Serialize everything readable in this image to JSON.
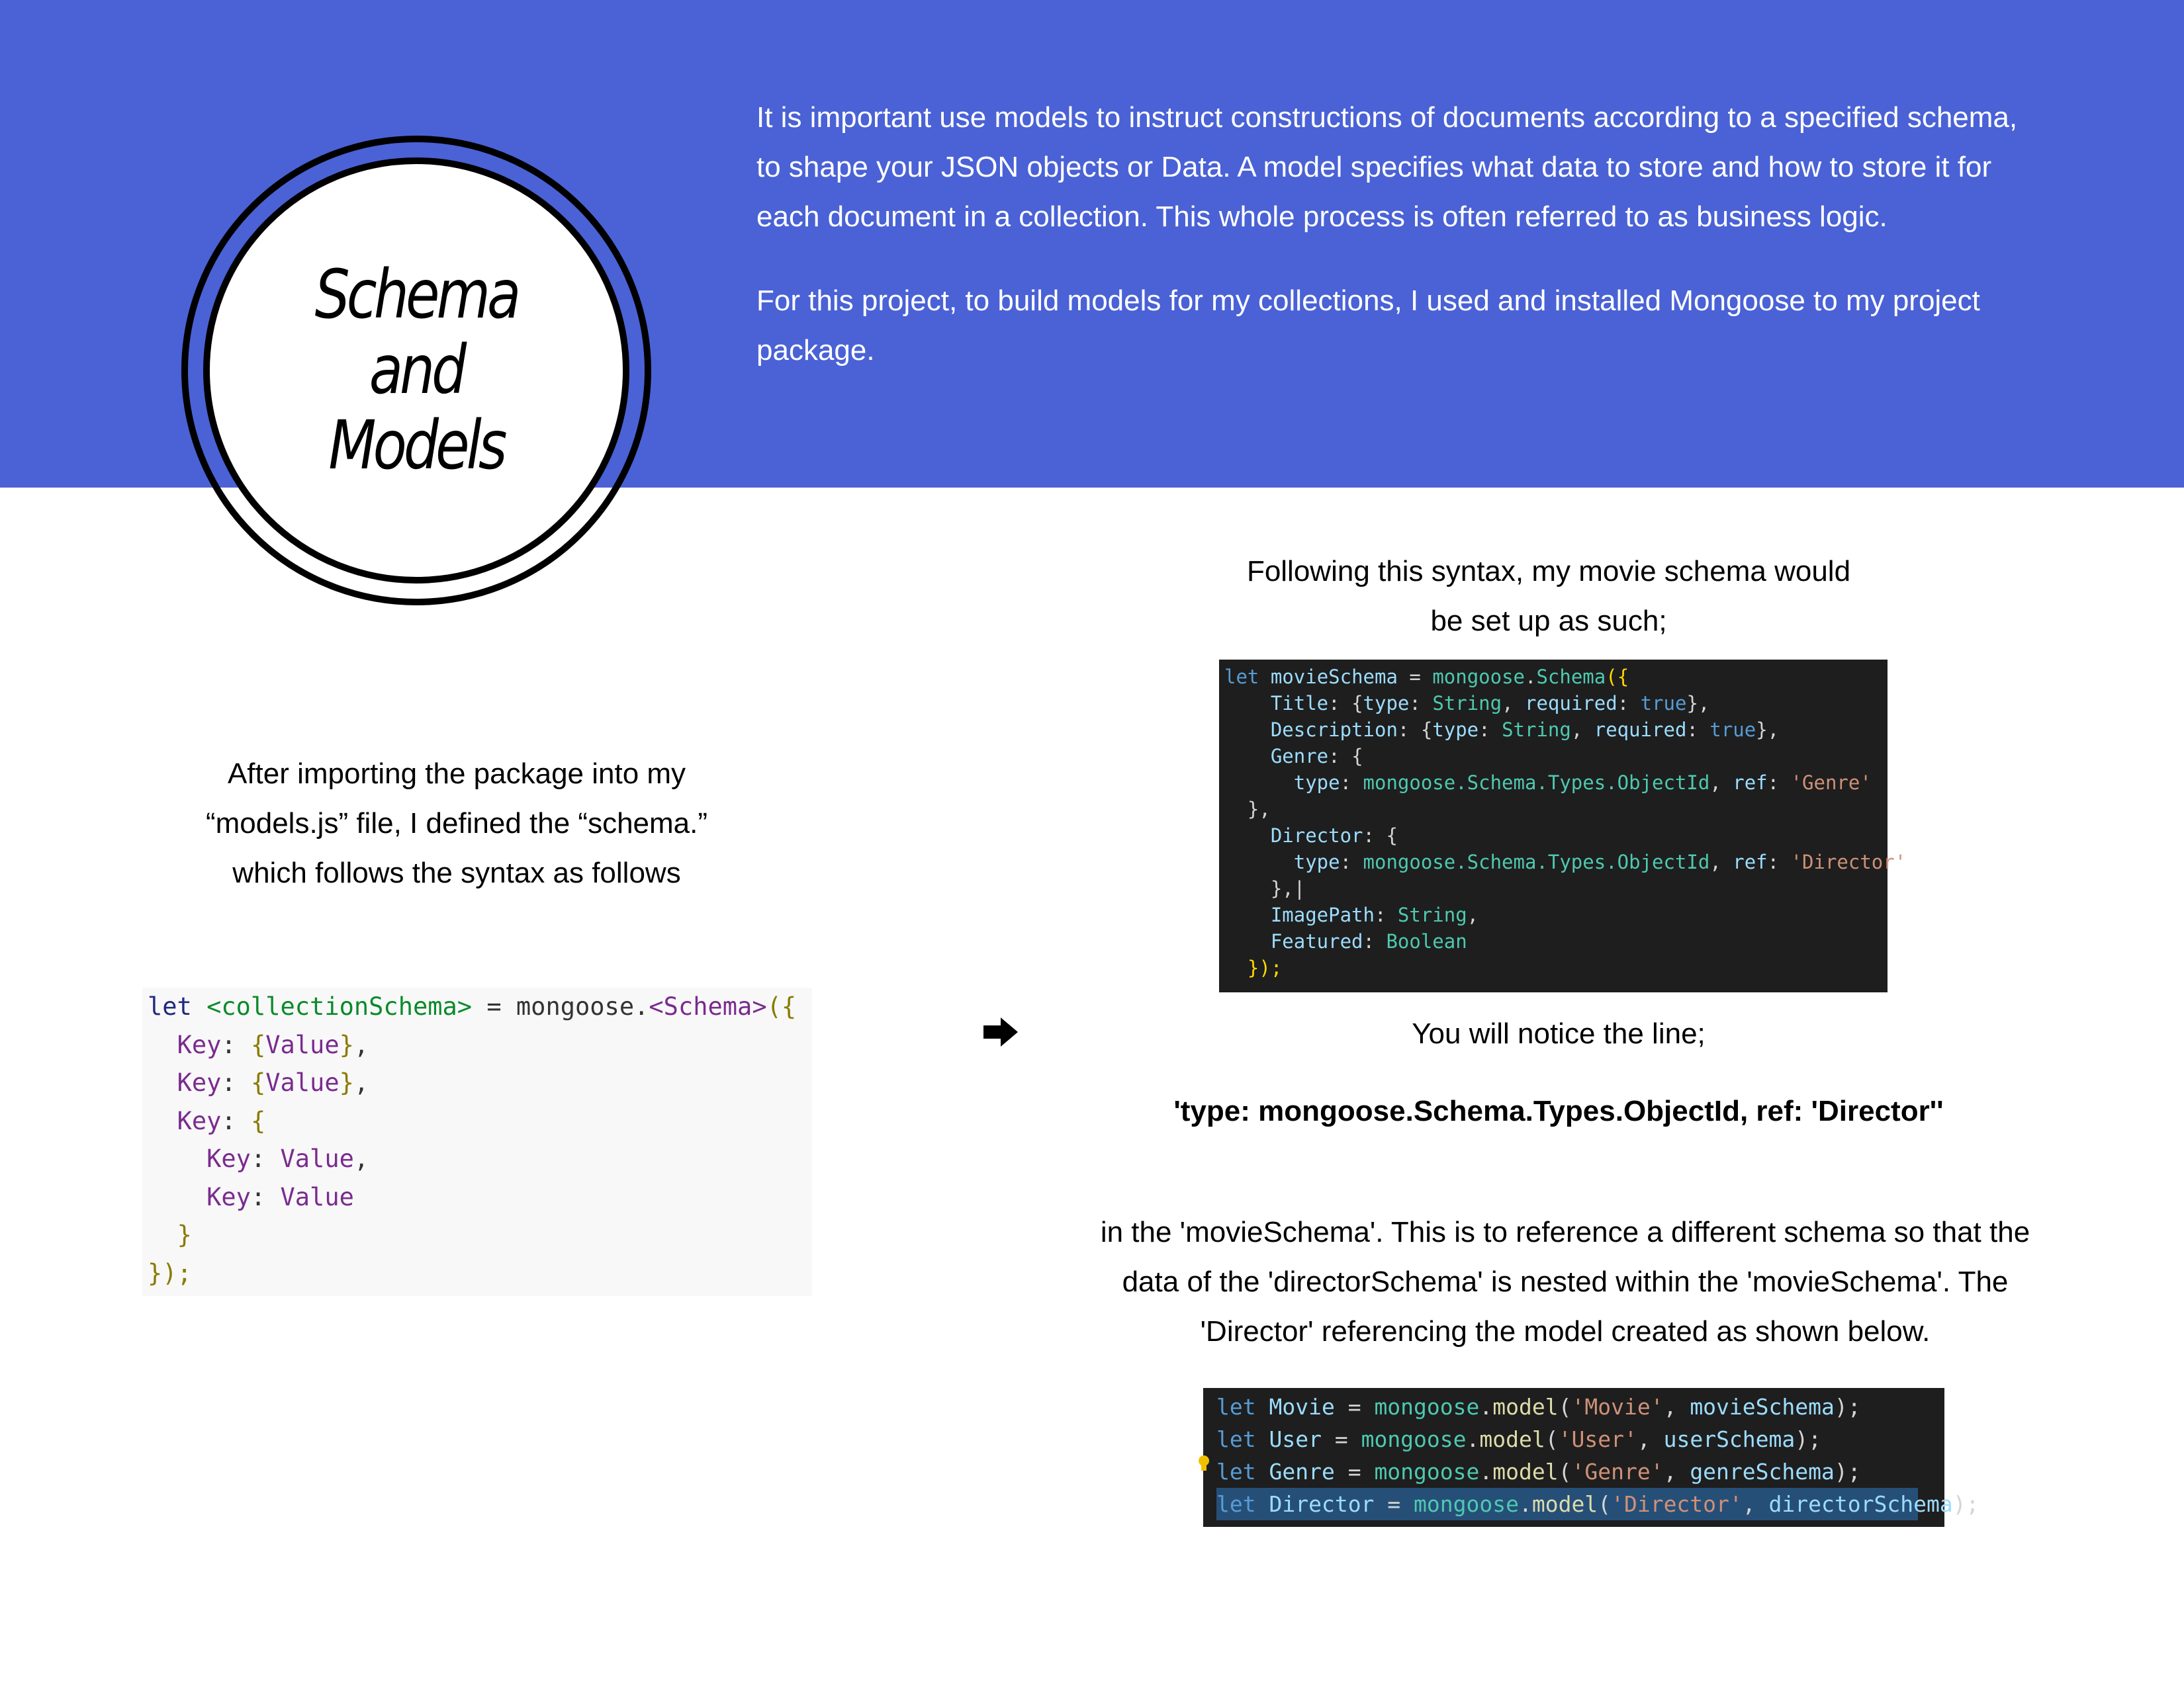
{
  "badge": {
    "title": "Schema and Models"
  },
  "intro": {
    "paragraph1": "It is important use models to instruct constructions of documents according to a specified schema, to shape your JSON objects or Data. A model specifies what data to store and how to store it for each document in a collection. This whole process is often referred to as business logic.",
    "paragraph2": "For this project, to build models for my collections, I used and installed Mongoose to my project package."
  },
  "left": {
    "caption": "After importing the package into my “models.js” file, I defined the “schema.” which follows the syntax as follows",
    "code": {
      "line1": {
        "kw": "let",
        "name": "<collectionSchema>",
        "eq": " = ",
        "obj": "mongoose",
        "dot": ".",
        "cls": "<Schema>",
        "open": "({"
      },
      "key": "Key",
      "value": "Value",
      "close_inner": "}",
      "close_outer": "});"
    }
  },
  "right": {
    "caption": "Following this syntax, my movie schema would be set up as such;",
    "notice": "You will notice the line;",
    "highlight": "'type: mongoose.Schema.Types.ObjectId, ref: 'Director''",
    "explanation": "in the 'movieSchema'. This is to reference a different schema so that the data of the 'directorSchema' is nested within the 'movieSchema'. The 'Director' referencing the model created as shown below."
  },
  "movie_code": {
    "let": "let",
    "var": "movieSchema",
    "mongoose": "mongoose",
    "schema": "Schema",
    "title": "Title",
    "description": "Description",
    "genre": "Genre",
    "director": "Director",
    "imagepath": "ImagePath",
    "featured": "Featured",
    "type": "type",
    "required": "required",
    "ref": "ref",
    "string": "String",
    "boolean": "Boolean",
    "true": "true",
    "types_path": "mongoose.Schema.Types.ObjectId",
    "genre_ref": "'Genre'",
    "director_ref": "'Director'"
  },
  "models_code": [
    {
      "name": "Movie",
      "model": "'Movie'",
      "schema": "movieSchema"
    },
    {
      "name": "User",
      "model": "'User'",
      "schema": "userSchema"
    },
    {
      "name": "Genre",
      "model": "'Genre'",
      "schema": "genreSchema"
    },
    {
      "name": "Director",
      "model": "'Director'",
      "schema": "directorSchema"
    }
  ],
  "models_code_common": {
    "let": "let",
    "mongoose": "mongoose",
    "method": "model"
  },
  "colors": {
    "banner": "#4a62d6",
    "code_dark_bg": "#1e1e1e",
    "code_light_bg": "#f8f8f8"
  },
  "icons": {
    "arrow": "right-arrow-icon",
    "lightbulb": "lightbulb-icon"
  }
}
